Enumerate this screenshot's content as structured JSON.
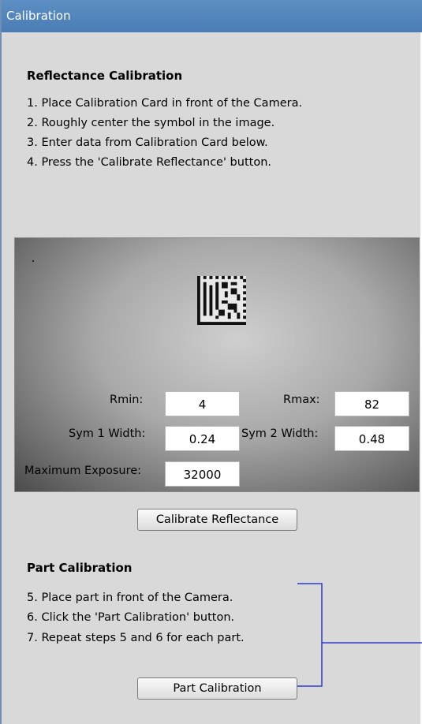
{
  "window": {
    "title": "Calibration"
  },
  "reflectance": {
    "heading": "Reflectance Calibration",
    "steps": [
      "1.  Place Calibration Card in front of the Camera.",
      "2.  Roughly center the symbol in the image.",
      "3.  Enter data from Calibration Card below.",
      "4.  Press the 'Calibrate Reflectance' button."
    ],
    "fields": {
      "rmin_label": "Rmin:",
      "rmin_value": "4",
      "rmax_label": "Rmax:",
      "rmax_value": "82",
      "sym1_label": "Sym 1 Width:",
      "sym1_value": "0.24",
      "sym2_label": "Sym 2 Width:",
      "sym2_value": "0.48",
      "max_exposure_label": "Maximum Exposure:",
      "max_exposure_value": "32000"
    },
    "button_label": "Calibrate Reflectance"
  },
  "part": {
    "heading": "Part Calibration",
    "steps": [
      "5.  Place part in front of the Camera.",
      "6.  Click the 'Part Calibration' button.",
      "7.  Repeat steps 5 and 6 for each part."
    ],
    "button_label": "Part Calibration"
  },
  "colors": {
    "title_bar": "#4a7db5",
    "panel_bg": "#d9d9d9",
    "bracket": "#2b3bcc"
  },
  "icons": {
    "camera_symbol": "datamatrix-symbol"
  }
}
